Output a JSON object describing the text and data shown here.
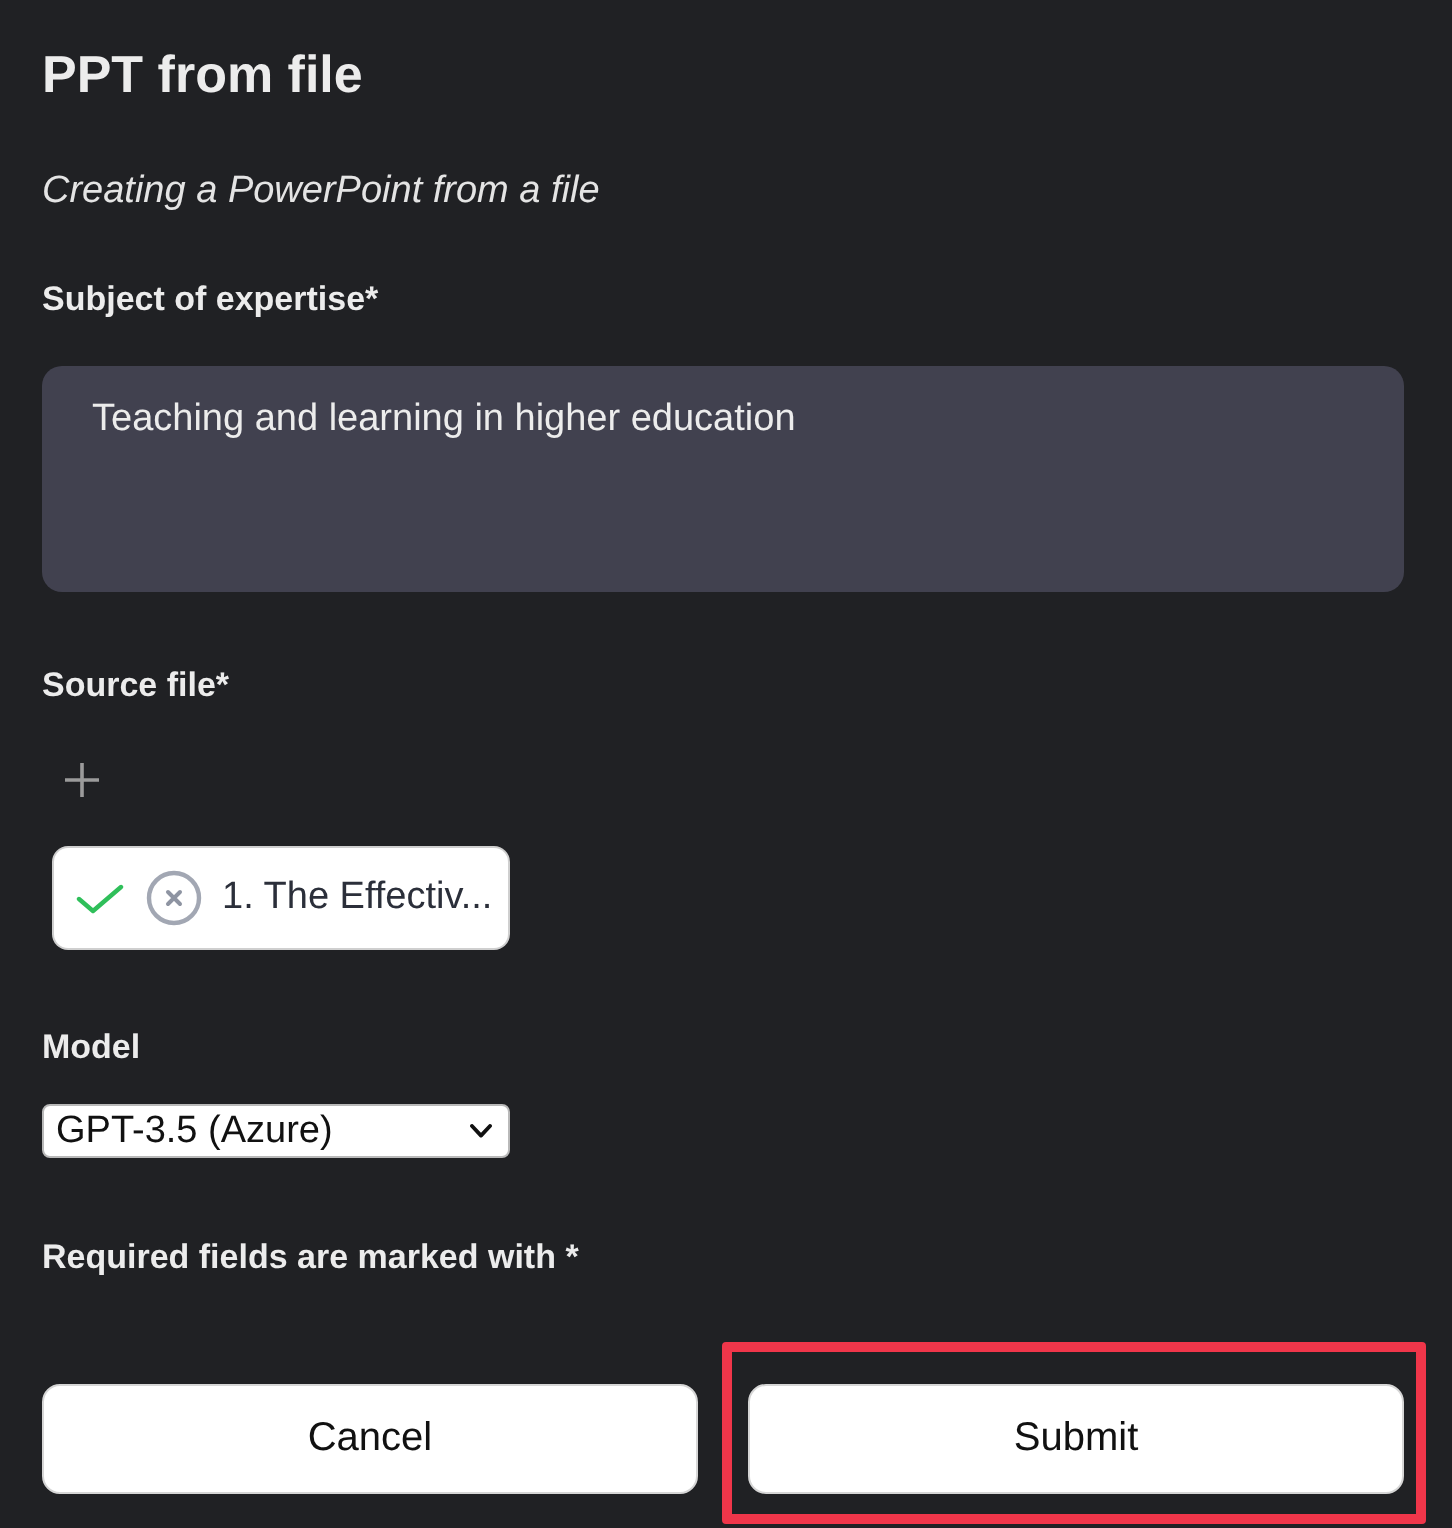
{
  "form": {
    "title": "PPT from file",
    "subtitle": "Creating a PowerPoint from a file"
  },
  "fields": [
    {
      "kind": "textarea",
      "label": "Subject of expertise*",
      "value": "Teaching and learning in higher education"
    },
    {
      "kind": "file",
      "label": "Source file*",
      "files": [
        {
          "name": "1. The Effectiv...",
          "uploaded": true
        }
      ]
    },
    {
      "kind": "select",
      "label": "Model",
      "value": "GPT-3.5 (Azure)"
    }
  ],
  "note": "Required fields are marked with *",
  "buttons": [
    {
      "label": "Cancel",
      "highlighted": false
    },
    {
      "label": "Submit",
      "highlighted": true
    }
  ]
}
